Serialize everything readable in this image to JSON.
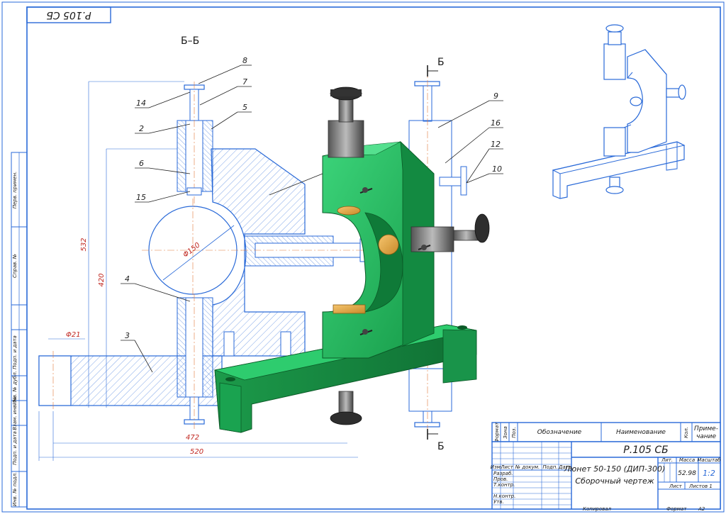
{
  "sheet": {
    "format_code": "Р.105 СБ",
    "section_label": "Б–Б",
    "cut_mark_top": "Б",
    "cut_mark_bottom": "Б"
  },
  "callouts": [
    {
      "id": "8",
      "text": "8"
    },
    {
      "id": "7",
      "text": "7"
    },
    {
      "id": "14",
      "text": "14"
    },
    {
      "id": "5",
      "text": "5"
    },
    {
      "id": "2",
      "text": "2"
    },
    {
      "id": "6",
      "text": "6"
    },
    {
      "id": "15",
      "text": "15"
    },
    {
      "id": "4",
      "text": "4"
    },
    {
      "id": "3",
      "text": "3"
    },
    {
      "id": "9",
      "text": "9"
    },
    {
      "id": "16",
      "text": "16"
    },
    {
      "id": "12",
      "text": "12"
    },
    {
      "id": "10",
      "text": "10"
    }
  ],
  "dimensions": {
    "d150": "Φ150",
    "d532": "532",
    "d420": "420",
    "d21": "Φ21",
    "d472": "472",
    "d520": "520"
  },
  "side_stamp": [
    "Перв. примен.",
    "Справ. №",
    "Подп. и дата",
    "Инв. № дубл.",
    "Взам. инв. №",
    "Подп. и дата",
    "Инв. № подл."
  ],
  "spec_header": {
    "format": "Формат",
    "zone": "Зона",
    "pos": "Поз.",
    "designation": "Обозначение",
    "name": "Наименование",
    "qty": "Кол.",
    "note1": "Приме-",
    "note2": "чание"
  },
  "title_block": {
    "doc_code": "Р.105 СБ",
    "title_line1": "Люнет 50-150 (ДИП-300)",
    "title_line2": "Сборочный чертеж",
    "col_lit": "Лит.",
    "col_mass": "Масса",
    "col_scale": "Масштаб",
    "mass": "52.98",
    "scale": "1:2",
    "rev_cols": [
      "Изм.",
      "Лист",
      "№ докум.",
      "Подп.",
      "Дата"
    ],
    "roles": [
      "Разраб.",
      "Пров.",
      "Т.контр.",
      "Н.контр.",
      "Утв."
    ],
    "sheet": "Лист",
    "sheets": "Листов 1",
    "copied": "Копировал",
    "format": "Формат",
    "format_value": "A2"
  }
}
